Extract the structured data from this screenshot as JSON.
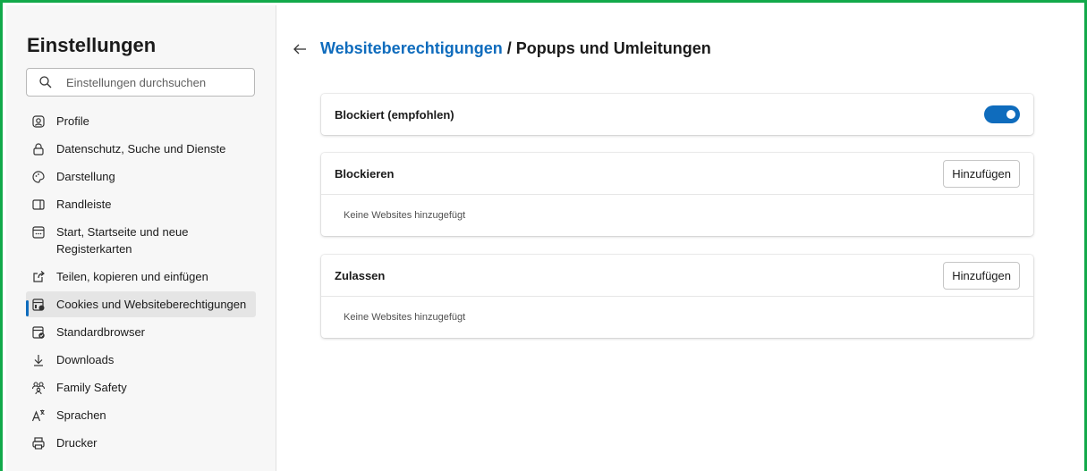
{
  "sidebar": {
    "title": "Einstellungen",
    "search_placeholder": "Einstellungen durchsuchen",
    "items": [
      {
        "label": "Profile",
        "icon": "profile-icon"
      },
      {
        "label": "Datenschutz, Suche und Dienste",
        "icon": "lock-icon"
      },
      {
        "label": "Darstellung",
        "icon": "palette-icon"
      },
      {
        "label": "Randleiste",
        "icon": "sidebar-icon"
      },
      {
        "label": "Start, Startseite und neue Registerkarten",
        "icon": "home-tab-icon"
      },
      {
        "label": "Teilen, kopieren und einfügen",
        "icon": "share-icon"
      },
      {
        "label": "Cookies und Websiteberechtigungen",
        "icon": "cookies-icon",
        "active": true
      },
      {
        "label": "Standardbrowser",
        "icon": "default-browser-icon"
      },
      {
        "label": "Downloads",
        "icon": "download-icon"
      },
      {
        "label": "Family Safety",
        "icon": "family-icon"
      },
      {
        "label": "Sprachen",
        "icon": "languages-icon"
      },
      {
        "label": "Drucker",
        "icon": "printer-icon"
      }
    ]
  },
  "header": {
    "breadcrumb_link": "Websiteberechtigungen",
    "separator": "/",
    "page_title": "Popups und Umleitungen"
  },
  "blocked_card": {
    "label": "Blockiert (empfohlen)",
    "toggle_on": true
  },
  "block_section": {
    "title": "Blockieren",
    "button": "Hinzufügen",
    "empty_text": "Keine Websites hinzugefügt"
  },
  "allow_section": {
    "title": "Zulassen",
    "button": "Hinzufügen",
    "empty_text": "Keine Websites hinzugefügt"
  },
  "colors": {
    "accent": "#0f6cbd",
    "frame": "#12a94a",
    "sidebar_bg": "#f7f7f7"
  }
}
